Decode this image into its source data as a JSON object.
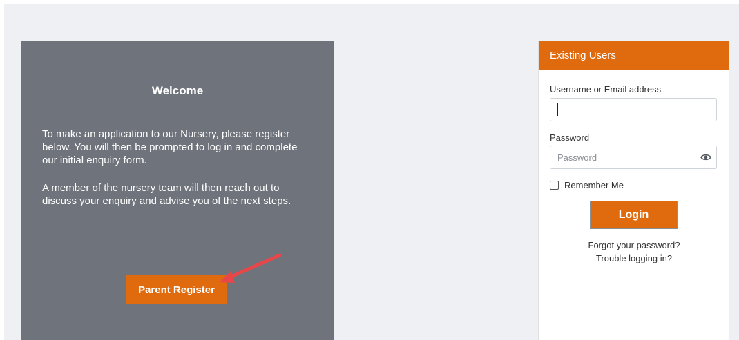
{
  "welcome": {
    "title": "Welcome",
    "paragraph_1": "To make an application to our Nursery, please register below. You will then be prompted to log in and complete our initial enquiry form.",
    "paragraph_2": "A member of the nursery team will then reach out to discuss your enquiry and advise you of the next steps.",
    "register_button_label": "Parent Register"
  },
  "login": {
    "header": "Existing Users",
    "username_label": "Username or Email address",
    "username_value": "",
    "password_label": "Password",
    "password_placeholder": "Password",
    "remember_label": "Remember Me",
    "login_button_label": "Login",
    "forgot_link": "Forgot your password?",
    "trouble_link": "Trouble logging in?"
  },
  "colors": {
    "accent": "#e06a0e",
    "welcome_panel": "#6f737b",
    "page_background": "#eef0f4",
    "annotation_arrow": "#e8474a"
  },
  "icons": {
    "password_toggle": "eye-icon",
    "annotation": "arrow-annotation"
  }
}
